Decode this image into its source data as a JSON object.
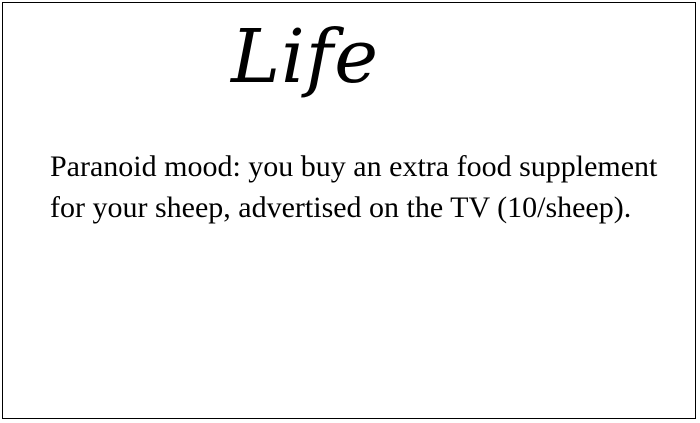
{
  "card": {
    "category": "Life",
    "text": "Paranoid mood: you buy an extra food supplement for your sheep, advertised on the TV (10/sheep).",
    "colors": {
      "border": "#000000",
      "background": "#ffffff",
      "text": "#000000"
    }
  }
}
